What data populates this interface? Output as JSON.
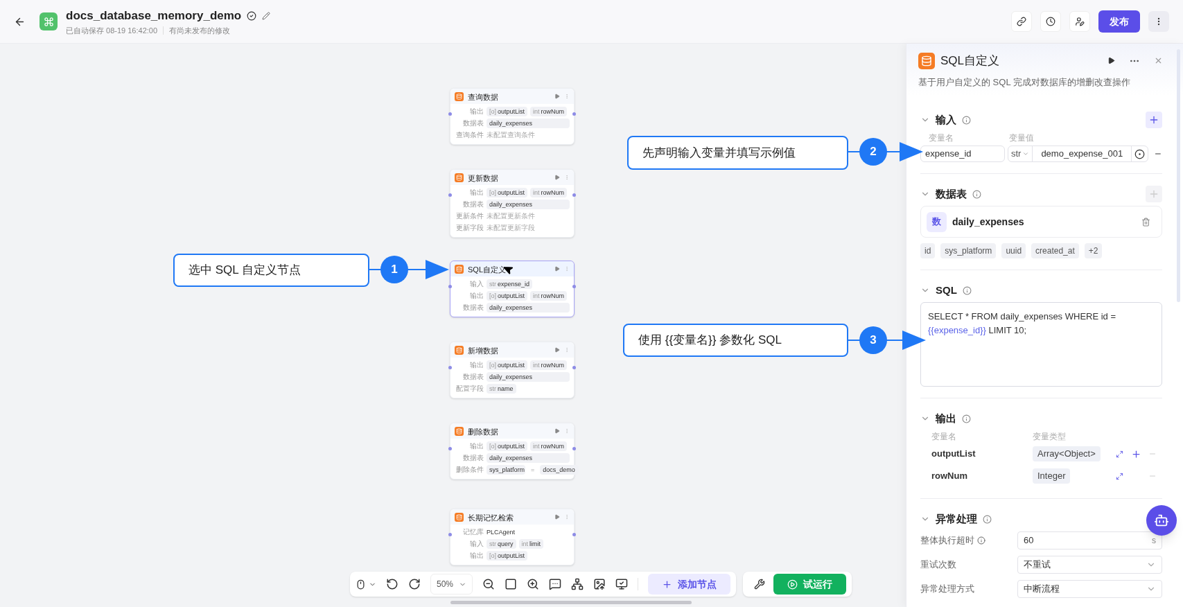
{
  "header": {
    "title": "docs_database_memory_demo",
    "autosave": "已自动保存 08-19 16:42:00",
    "status": "有尚未发布的修改",
    "publish": "发布"
  },
  "canvas": {
    "nodes": [
      {
        "title": "查询数据",
        "selected": false,
        "rows": [
          {
            "label": "输出",
            "kind": "tags",
            "tags": [
              {
                "type": "[o]",
                "name": "outputList"
              },
              {
                "type": "int",
                "name": "rowNum"
              }
            ]
          },
          {
            "label": "数据表",
            "kind": "value",
            "value": "daily_expenses"
          },
          {
            "label": "查询条件",
            "kind": "hint",
            "value": "未配置查询条件"
          }
        ]
      },
      {
        "title": "更新数据",
        "selected": false,
        "rows": [
          {
            "label": "输出",
            "kind": "tags",
            "tags": [
              {
                "type": "[o]",
                "name": "outputList"
              },
              {
                "type": "int",
                "name": "rowNum"
              }
            ]
          },
          {
            "label": "数据表",
            "kind": "value",
            "value": "daily_expenses"
          },
          {
            "label": "更新条件",
            "kind": "hint",
            "value": "未配置更新条件"
          },
          {
            "label": "更新字段",
            "kind": "hint",
            "value": "未配置更新字段"
          }
        ]
      },
      {
        "title": "SQL自定义",
        "selected": true,
        "rows": [
          {
            "label": "输入",
            "kind": "tags",
            "tags": [
              {
                "type": "str",
                "name": "expense_id"
              }
            ]
          },
          {
            "label": "输出",
            "kind": "tags",
            "tags": [
              {
                "type": "[o]",
                "name": "outputList"
              },
              {
                "type": "int",
                "name": "rowNum"
              }
            ]
          },
          {
            "label": "数据表",
            "kind": "value",
            "value": "daily_expenses"
          }
        ]
      },
      {
        "title": "新增数据",
        "selected": false,
        "rows": [
          {
            "label": "输出",
            "kind": "tags",
            "tags": [
              {
                "type": "[o]",
                "name": "outputList"
              },
              {
                "type": "int",
                "name": "rowNum"
              }
            ]
          },
          {
            "label": "数据表",
            "kind": "value",
            "value": "daily_expenses"
          },
          {
            "label": "配置字段",
            "kind": "tags",
            "tags": [
              {
                "type": "str",
                "name": "name"
              }
            ]
          }
        ]
      },
      {
        "title": "删除数据",
        "selected": false,
        "rows": [
          {
            "label": "输出",
            "kind": "tags",
            "tags": [
              {
                "type": "[o]",
                "name": "outputList"
              },
              {
                "type": "int",
                "name": "rowNum"
              }
            ]
          },
          {
            "label": "数据表",
            "kind": "value",
            "value": "daily_expenses"
          },
          {
            "label": "删除条件",
            "kind": "condition",
            "left": "sys_platform",
            "op": "=",
            "right": "docs_demo"
          }
        ]
      },
      {
        "title": "长期记忆检索",
        "selected": false,
        "rows": [
          {
            "label": "记忆库",
            "kind": "text",
            "value": "PLCAgent"
          },
          {
            "label": "输入",
            "kind": "tags",
            "tags": [
              {
                "type": "str",
                "name": "query"
              },
              {
                "type": "int",
                "name": "limit"
              }
            ]
          },
          {
            "label": "输出",
            "kind": "tags",
            "tags": [
              {
                "type": "[o]",
                "name": "outputList"
              }
            ]
          }
        ]
      }
    ]
  },
  "callouts": [
    {
      "number": "1",
      "text": "选中 SQL 自定义节点"
    },
    {
      "number": "2",
      "text": "先声明输入变量并填写示例值"
    },
    {
      "number": "3",
      "text": "使用 {{变量名}} 参数化 SQL"
    }
  ],
  "toolbar": {
    "zoom": "50%",
    "add_node": "添加节点",
    "run": "试运行"
  },
  "panel": {
    "title": "SQL自定义",
    "description": "基于用户自定义的 SQL 完成对数据库的增删改查操作",
    "inputs": {
      "title": "输入",
      "add_enabled": true,
      "col_name": "变量名",
      "col_value": "变量值",
      "rows": [
        {
          "name": "expense_id",
          "type": "str",
          "value": "demo_expense_001"
        }
      ]
    },
    "tables": {
      "title": "数据表",
      "add_enabled": false,
      "items": [
        {
          "badge": "数",
          "name": "daily_expenses"
        }
      ],
      "fields": [
        "id",
        "sys_platform",
        "uuid",
        "created_at",
        "+2"
      ]
    },
    "sql": {
      "title": "SQL",
      "parts": [
        {
          "kind": "plain",
          "text": "SELECT * FROM daily_expenses WHERE id = "
        },
        {
          "kind": "variable",
          "text": "{{expense_id}}"
        },
        {
          "kind": "plain",
          "text": " LIMIT 10;"
        }
      ]
    },
    "outputs": {
      "title": "输出",
      "col_name": "变量名",
      "col_type": "变量类型",
      "rows": [
        {
          "name": "outputList",
          "type": "Array<Object>",
          "can_add": true
        },
        {
          "name": "rowNum",
          "type": "Integer",
          "can_add": false
        }
      ]
    },
    "errors": {
      "title": "异常处理",
      "timeout": {
        "label": "整体执行超时",
        "value": "60",
        "unit": "s"
      },
      "retry": {
        "label": "重试次数",
        "value": "不重试"
      },
      "mode": {
        "label": "异常处理方式",
        "value": "中断流程"
      }
    }
  }
}
